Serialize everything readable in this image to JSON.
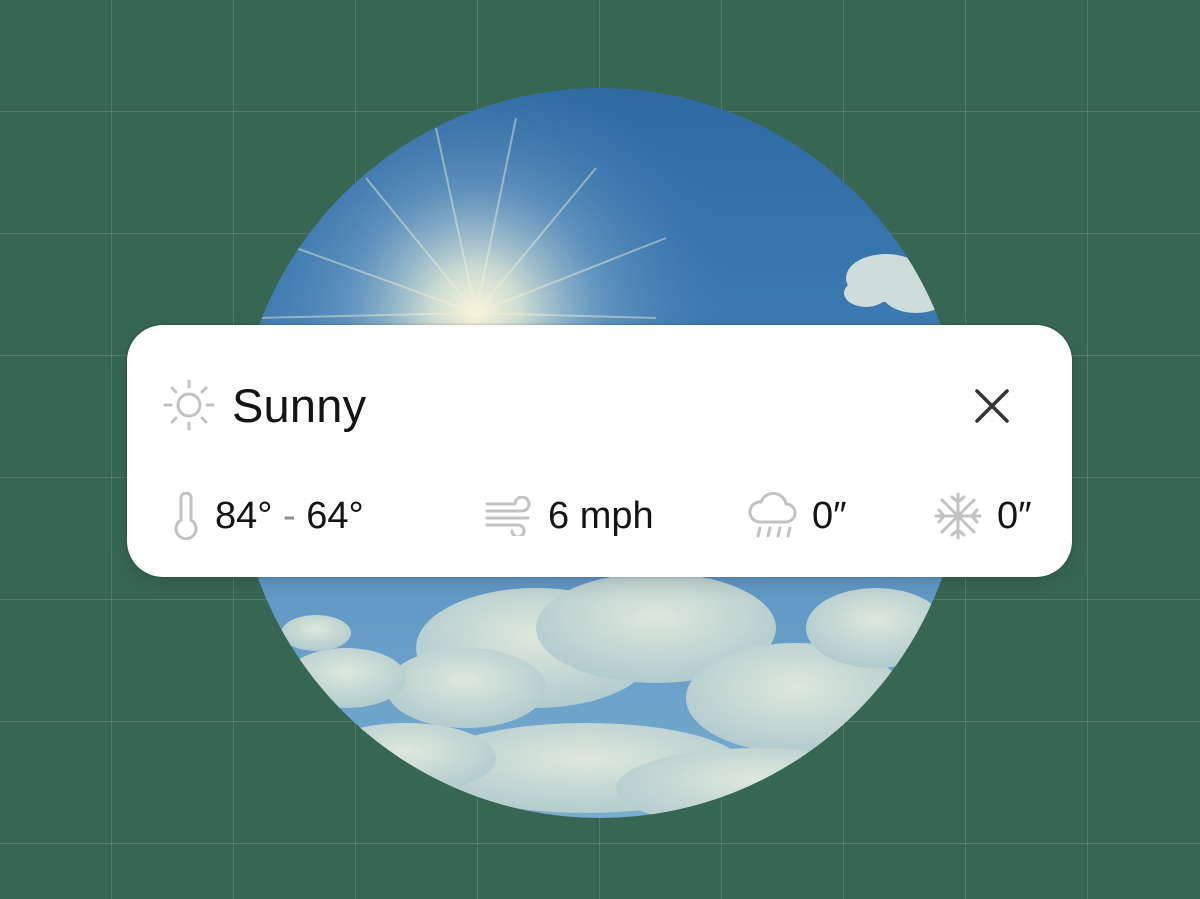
{
  "weather": {
    "condition": "Sunny",
    "condition_icon": "sun-icon",
    "close_icon": "close-icon"
  },
  "stats": {
    "temperature": {
      "icon": "thermometer-icon",
      "high": "84°",
      "separator": "-",
      "low": "64°"
    },
    "wind": {
      "icon": "wind-icon",
      "value": "6 mph"
    },
    "rain": {
      "icon": "rain-cloud-icon",
      "value": "0″"
    },
    "snow": {
      "icon": "snowflake-icon",
      "value": "0″"
    }
  },
  "colors": {
    "background": "#376753",
    "card": "#ffffff",
    "text": "#141414",
    "icon": "#c2c2c2"
  }
}
